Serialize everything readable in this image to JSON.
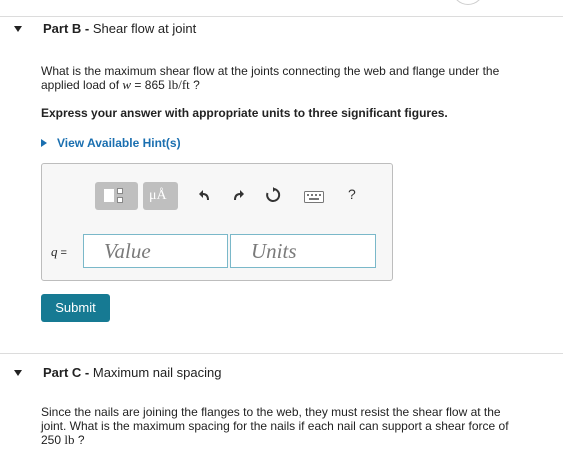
{
  "partB": {
    "part_label": "Part B",
    "dash": " - ",
    "title": "Shear flow at joint",
    "question_line1": "What is the maximum shear flow at the joints connecting the web and flange under the",
    "question_line2_pre": "applied load of",
    "question_var": "w",
    "question_eq": " = 865 ",
    "question_unit": "lb/ft",
    "question_end": " ?",
    "instruction": "Express your answer with appropriate units to three significant figures.",
    "hint_link": "View Available Hint(s)",
    "toolbar": {
      "mu_label": "μÅ",
      "help_label": "?"
    },
    "answer_var": "q",
    "answer_eq": " =",
    "value_placeholder": "Value",
    "units_placeholder": "Units",
    "submit_label": "Submit"
  },
  "partC": {
    "part_label": "Part C",
    "dash": " - ",
    "title": "Maximum nail spacing",
    "line1": "Since the nails are joining the flanges to the web, they must resist the shear flow at the",
    "line2": "joint. What is the maximum spacing for the nails if each nail can support a shear force of",
    "line3_num": "250 ",
    "line3_unit": "lb",
    "line3_end": " ?"
  },
  "colors": {
    "accent": "#1a6fb0",
    "submit_bg": "#167a93",
    "field_border": "#7ab8c9"
  }
}
